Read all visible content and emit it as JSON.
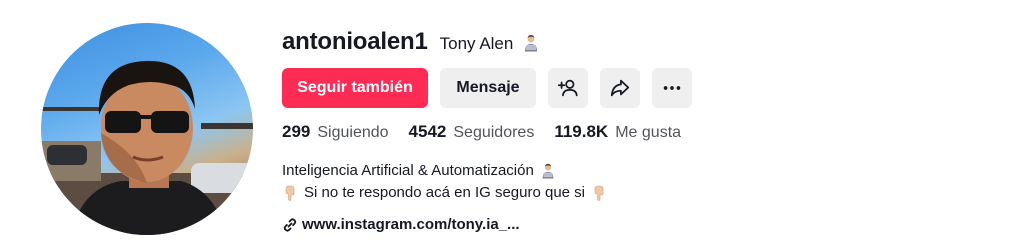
{
  "profile": {
    "username": "antonioalen1",
    "nickname": "Tony Alen",
    "nickname_emoji": "technologist-emoji"
  },
  "actions": {
    "follow_label": "Seguir también",
    "message_label": "Mensaje",
    "add_friend_icon": "add-user-icon",
    "share_icon": "share-arrow-icon",
    "more_icon": "more-dots-icon"
  },
  "stats": {
    "following_count": "299",
    "following_label": "Siguiendo",
    "followers_count": "4542",
    "followers_label": "Seguidores",
    "likes_count": "119.8K",
    "likes_label": "Me gusta"
  },
  "bio": {
    "line1": "Inteligencia Artificial & Automatización",
    "line2": "Si no te respondo acá en IG seguro que si"
  },
  "link": {
    "text": "www.instagram.com/tony.ia_..."
  },
  "colors": {
    "accent": "#fe2c55",
    "button_bg": "#efefef",
    "text": "#161823"
  }
}
